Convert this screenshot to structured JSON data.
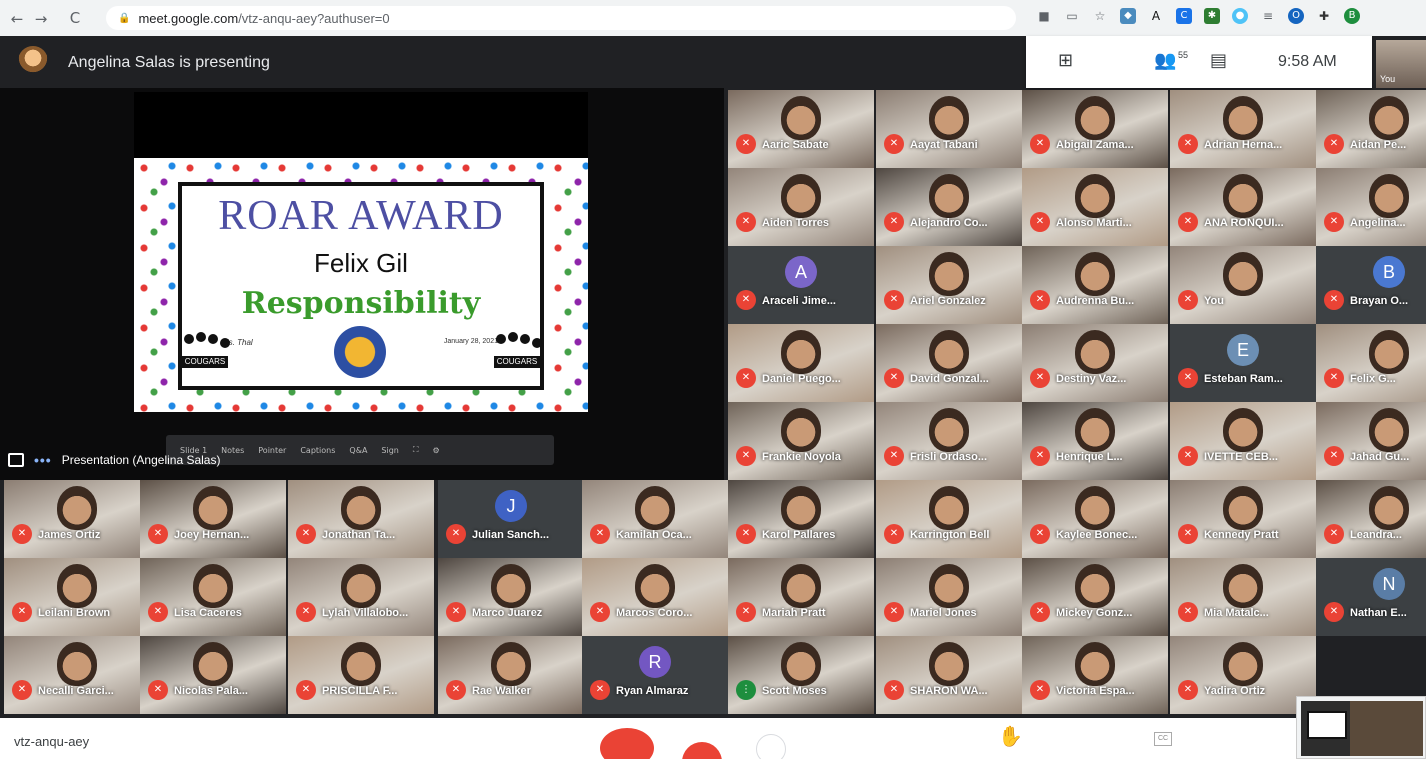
{
  "browser": {
    "url_host": "meet.google.com",
    "url_path": "/vtz-anqu-aey?authuser=0",
    "nav": {
      "back": "←",
      "forward": "→",
      "reload": "C"
    }
  },
  "banner": {
    "text": "Angelina Salas is presenting"
  },
  "top_panel": {
    "grid_icon": "grid-icon",
    "people_count": "55",
    "chat_icon": "chat-icon",
    "time": "9:58 AM",
    "self_label": "You"
  },
  "slide": {
    "title": "ROAR AWARD",
    "name": "Felix Gil",
    "trait": "Responsibility",
    "signature": "Ms. Thal",
    "date": "January 28, 2021",
    "paw_label": "COUGARS"
  },
  "presentation_label": "Presentation (Angelina Salas)",
  "presentation_toolbar": [
    "Slide 1",
    "Notes",
    "Pointer",
    "Captions",
    "Q&A",
    "Sign"
  ],
  "participants": [
    {
      "name": "Aaric Sabate"
    },
    {
      "name": "Aayat Tabani"
    },
    {
      "name": "Abigail Zama..."
    },
    {
      "name": "Adrian Herna..."
    },
    {
      "name": "Aidan Pe..."
    },
    {
      "name": "Aiden Torres"
    },
    {
      "name": "Alejandro Co..."
    },
    {
      "name": "Alonso Marti..."
    },
    {
      "name": "ANA RONQUI..."
    },
    {
      "name": "Angelina..."
    },
    {
      "name": "Araceli Jime...",
      "initial": "A"
    },
    {
      "name": "Ariel Gonzalez"
    },
    {
      "name": "Audrenna Bu..."
    },
    {
      "name": "You"
    },
    {
      "name": "Brayan O...",
      "initial": "B"
    },
    {
      "name": "Daniel Puego..."
    },
    {
      "name": "David Gonzal..."
    },
    {
      "name": "Destiny Vaz..."
    },
    {
      "name": "Esteban Ram...",
      "initial": "E"
    },
    {
      "name": "Felix G..."
    },
    {
      "name": "Frankie Noyola"
    },
    {
      "name": "Frisli Ordaso..."
    },
    {
      "name": "Henrique L..."
    },
    {
      "name": "IVETTE CEB..."
    },
    {
      "name": "Jahad Gu..."
    },
    {
      "name": "James Ortiz"
    },
    {
      "name": "Joey Hernan..."
    },
    {
      "name": "Jonathan Ta..."
    },
    {
      "name": "Julian Sanch...",
      "initial": "J"
    },
    {
      "name": "Kamilah Oca..."
    },
    {
      "name": "Karol Pallares"
    },
    {
      "name": "Karrington Bell"
    },
    {
      "name": "Kaylee Bonec..."
    },
    {
      "name": "Kennedy Pratt"
    },
    {
      "name": "Leandra..."
    },
    {
      "name": "Leilani Brown"
    },
    {
      "name": "Lisa Caceres"
    },
    {
      "name": "Lylah Villalobo..."
    },
    {
      "name": "Marco Juarez"
    },
    {
      "name": "Marcos Coro..."
    },
    {
      "name": "Mariah Pratt"
    },
    {
      "name": "Mariel Jones"
    },
    {
      "name": "Mickey Gonz..."
    },
    {
      "name": "Mia Matalc..."
    },
    {
      "name": "Nathan E...",
      "initial": "N"
    },
    {
      "name": "Necalli Garci..."
    },
    {
      "name": "Nicolas Pala..."
    },
    {
      "name": "PRISCILLA F..."
    },
    {
      "name": "Rae Walker"
    },
    {
      "name": "Ryan Almaraz",
      "initial": "R"
    },
    {
      "name": "Scott Moses"
    },
    {
      "name": "SHARON WA..."
    },
    {
      "name": "Victoria Espa..."
    },
    {
      "name": "Yadira Ortiz"
    }
  ],
  "bottom": {
    "meeting_code": "vtz-anqu-aey",
    "hand_icon": "raise-hand-icon",
    "cc_label": "CC"
  },
  "colors": {
    "mic_off": "#ea4335",
    "accent": "#1a73e8",
    "tile_bg": "#3c4043"
  }
}
